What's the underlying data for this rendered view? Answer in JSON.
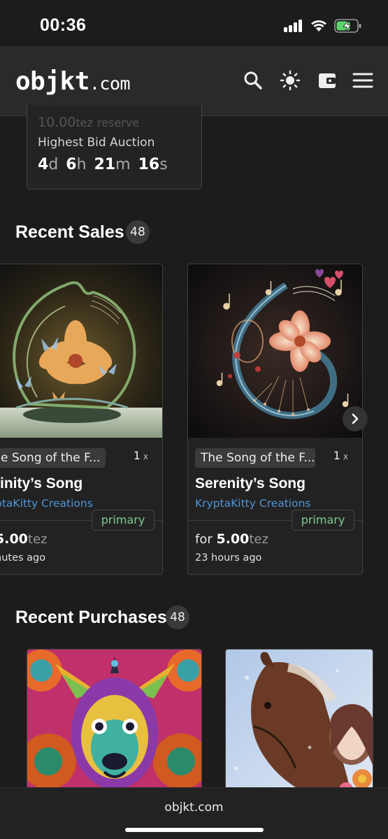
{
  "status_bar": {
    "time": "00:36"
  },
  "header": {
    "logo_main": "objkt",
    "logo_tld": ".com"
  },
  "auction": {
    "reserve_value": "10.00",
    "reserve_unit": "tez",
    "reserve_label": "reserve",
    "type": "Highest Bid Auction",
    "countdown": {
      "days": "4",
      "d": "d",
      "hours": "6",
      "h": "h",
      "minutes": "21",
      "m": "m",
      "seconds": "16",
      "s": "s"
    }
  },
  "recent_sales": {
    "title": "Recent Sales",
    "count": "48",
    "cards": [
      {
        "collection": "e Song of the F...",
        "edition": "1",
        "edition_unit": "x",
        "title": "finity’s Song",
        "creator": "ptaKitty Creations",
        "badge": "primary",
        "price_prefix": "",
        "price": "5.00",
        "price_unit": "tez",
        "time_ago": "nutes ago"
      },
      {
        "collection": "The Song of the F...",
        "edition": "1",
        "edition_unit": "x",
        "title": "Serenity’s Song",
        "creator": "KryptaKitty Creations",
        "badge": "primary",
        "price_prefix": "for ",
        "price": "5.00",
        "price_unit": "tez",
        "time_ago": "23 hours ago"
      }
    ]
  },
  "recent_purchases": {
    "title": "Recent Purchases",
    "count": "48"
  },
  "browser": {
    "url": "objkt.com"
  }
}
